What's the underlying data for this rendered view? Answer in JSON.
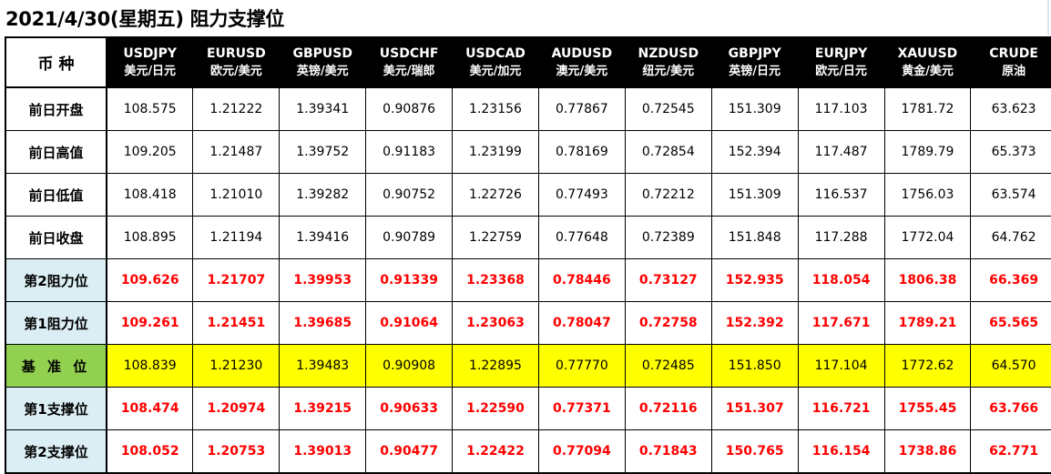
{
  "title": "2021/4/30(星期五) 阻力支撑位",
  "table": {
    "corner_label": "币 种",
    "columns": [
      {
        "code": "USDJPY",
        "name": "美元/日元"
      },
      {
        "code": "EURUSD",
        "name": "欧元/美元"
      },
      {
        "code": "GBPUSD",
        "name": "英镑/美元"
      },
      {
        "code": "USDCHF",
        "name": "美元/瑞郎"
      },
      {
        "code": "USDCAD",
        "name": "美元/加元"
      },
      {
        "code": "AUDUSD",
        "name": "澳元/美元"
      },
      {
        "code": "NZDUSD",
        "name": "纽元/美元"
      },
      {
        "code": "GBPJPY",
        "name": "英镑/日元"
      },
      {
        "code": "EURJPY",
        "name": "欧元/日元"
      },
      {
        "code": "XAUUSD",
        "name": "黄金/美元"
      },
      {
        "code": "CRUDE",
        "name": "原油"
      }
    ],
    "rows": [
      {
        "label": "前日开盘",
        "type": "prev",
        "values": [
          "108.575",
          "1.21222",
          "1.39341",
          "0.90876",
          "1.23156",
          "0.77867",
          "0.72545",
          "151.309",
          "117.103",
          "1781.72",
          "63.623"
        ]
      },
      {
        "label": "前日高值",
        "type": "prev",
        "values": [
          "109.205",
          "1.21487",
          "1.39752",
          "0.91183",
          "1.23199",
          "0.78169",
          "0.72854",
          "152.394",
          "117.487",
          "1789.79",
          "65.373"
        ]
      },
      {
        "label": "前日低值",
        "type": "prev",
        "values": [
          "108.418",
          "1.21010",
          "1.39282",
          "0.90752",
          "1.22726",
          "0.77493",
          "0.72212",
          "151.309",
          "116.537",
          "1756.03",
          "63.574"
        ]
      },
      {
        "label": "前日收盘",
        "type": "prev",
        "values": [
          "108.895",
          "1.21194",
          "1.39416",
          "0.90789",
          "1.22759",
          "0.77648",
          "0.72389",
          "151.848",
          "117.288",
          "1772.04",
          "64.762"
        ]
      },
      {
        "label": "第2阻力位",
        "type": "level",
        "values": [
          "109.626",
          "1.21707",
          "1.39953",
          "0.91339",
          "1.23368",
          "0.78446",
          "0.73127",
          "152.935",
          "118.054",
          "1806.38",
          "66.369"
        ]
      },
      {
        "label": "第1阻力位",
        "type": "level",
        "values": [
          "109.261",
          "1.21451",
          "1.39685",
          "0.91064",
          "1.23063",
          "0.78047",
          "0.72758",
          "152.392",
          "117.671",
          "1789.21",
          "65.565"
        ]
      },
      {
        "label": "基 准 位",
        "type": "pivot",
        "values": [
          "108.839",
          "1.21230",
          "1.39483",
          "0.90908",
          "1.22895",
          "0.77770",
          "0.72485",
          "151.850",
          "117.104",
          "1772.62",
          "64.570"
        ]
      },
      {
        "label": "第1支撑位",
        "type": "level",
        "values": [
          "108.474",
          "1.20974",
          "1.39215",
          "0.90633",
          "1.22590",
          "0.77371",
          "0.72116",
          "151.307",
          "116.721",
          "1755.45",
          "63.766"
        ]
      },
      {
        "label": "第2支撑位",
        "type": "level",
        "values": [
          "108.052",
          "1.20753",
          "1.39013",
          "0.90477",
          "1.22422",
          "0.77094",
          "0.71843",
          "150.765",
          "116.154",
          "1738.86",
          "62.771"
        ]
      }
    ]
  },
  "colors": {
    "header_bg": "#000000",
    "level_label_bg": "#daeef3",
    "pivot_label_bg": "#92d050",
    "pivot_row_bg": "#ffff00",
    "level_text": "#ff0000"
  }
}
